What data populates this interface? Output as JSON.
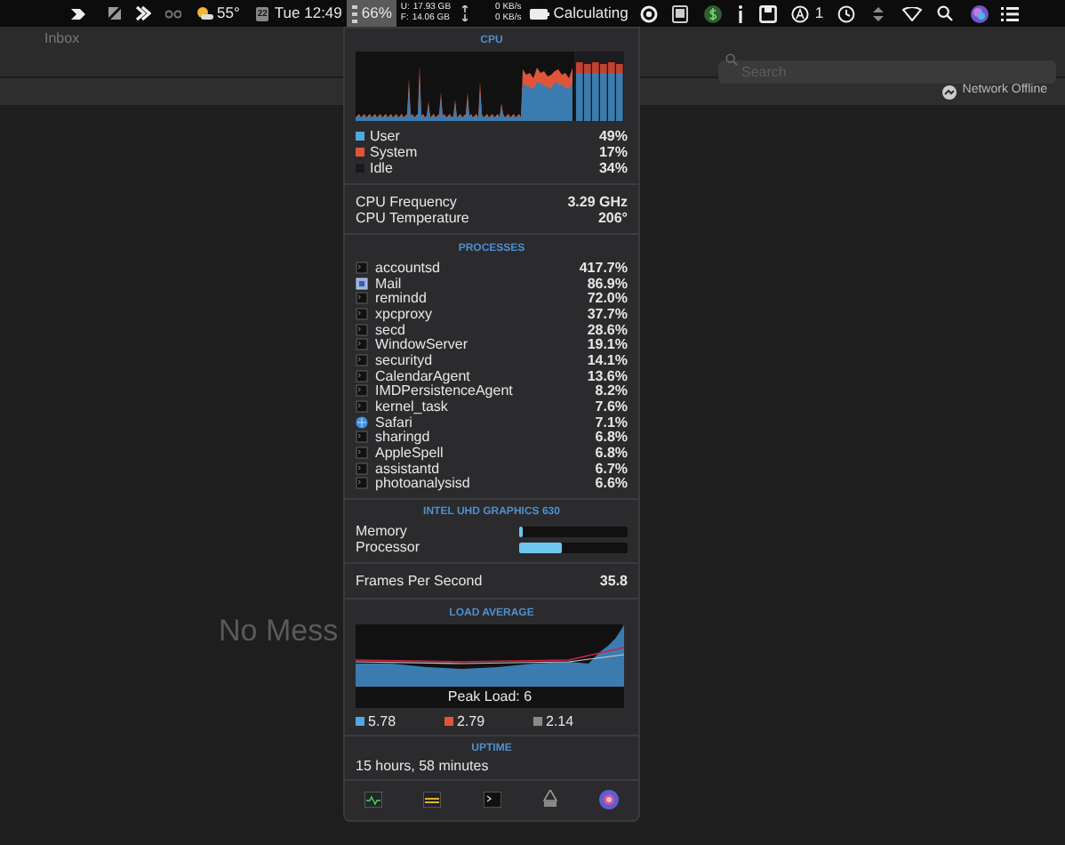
{
  "menu_bar": {
    "temperature": "55°",
    "calendar_day": "22",
    "clock": "Tue 12:49",
    "cpu_percent": "66%",
    "cpu_selected": true,
    "memory": [
      {
        "label": "U:",
        "value": "17.93 GB"
      },
      {
        "label": "F:",
        "value": "14.06 GB"
      }
    ],
    "network": [
      "0 KB/s",
      "0 KB/s"
    ],
    "battery_status": "Calculating",
    "notification_count": "1"
  },
  "mail_window": {
    "mailbox_title": "Inbox",
    "search": {
      "placeholder": "Search"
    },
    "network_status": "Network Offline",
    "empty_message": "No Mess"
  },
  "cpu_panel": {
    "header": "CPU",
    "legend": [
      {
        "label": "User",
        "value": "49%",
        "color": "#4fa8e0"
      },
      {
        "label": "System",
        "value": "17%",
        "color": "#e0553a"
      },
      {
        "label": "Idle",
        "value": "34%",
        "color": "#1a1a1c"
      }
    ],
    "stats": [
      {
        "label": "CPU Frequency",
        "value": "3.29 GHz"
      },
      {
        "label": "CPU Temperature",
        "value": "206°"
      }
    ]
  },
  "processes": {
    "header": "PROCESSES",
    "rows": [
      {
        "name": "accountsd",
        "value": "417.7%",
        "kind": "terminal"
      },
      {
        "name": "Mail",
        "value": "86.9%",
        "kind": "mail"
      },
      {
        "name": "remindd",
        "value": "72.0%",
        "kind": "terminal"
      },
      {
        "name": "xpcproxy",
        "value": "37.7%",
        "kind": "terminal"
      },
      {
        "name": "secd",
        "value": "28.6%",
        "kind": "terminal"
      },
      {
        "name": "WindowServer",
        "value": "19.1%",
        "kind": "terminal"
      },
      {
        "name": "securityd",
        "value": "14.1%",
        "kind": "terminal"
      },
      {
        "name": "CalendarAgent",
        "value": "13.6%",
        "kind": "terminal"
      },
      {
        "name": "IMDPersistenceAgent",
        "value": "8.2%",
        "kind": "terminal"
      },
      {
        "name": "kernel_task",
        "value": "7.6%",
        "kind": "terminal"
      },
      {
        "name": "Safari",
        "value": "7.1%",
        "kind": "safari"
      },
      {
        "name": "sharingd",
        "value": "6.8%",
        "kind": "terminal"
      },
      {
        "name": "AppleSpell",
        "value": "6.8%",
        "kind": "terminal"
      },
      {
        "name": "assistantd",
        "value": "6.7%",
        "kind": "terminal"
      },
      {
        "name": "photoanalysisd",
        "value": "6.6%",
        "kind": "terminal"
      }
    ]
  },
  "gpu": {
    "header": "INTEL UHD GRAPHICS 630",
    "meters": [
      {
        "label": "Memory",
        "level": 0.03
      },
      {
        "label": "Processor",
        "level": 0.4
      }
    ],
    "fps_label": "Frames Per Second",
    "fps_value": "35.8"
  },
  "load_average": {
    "header": "LOAD AVERAGE",
    "peak_label": "Peak Load: 6",
    "legend": [
      {
        "value": "5.78",
        "color": "#4fa8e0"
      },
      {
        "value": "2.79",
        "color": "#e0553a"
      },
      {
        "value": "2.14",
        "color": "#8a8a8a"
      }
    ]
  },
  "uptime": {
    "header": "UPTIME",
    "value": "15 hours, 58 minutes"
  }
}
